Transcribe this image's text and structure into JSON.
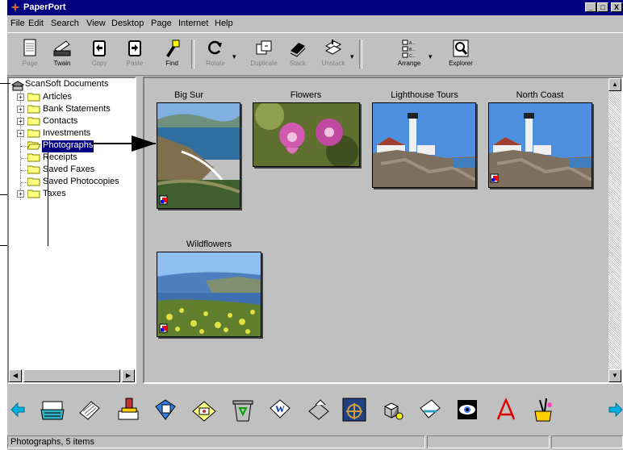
{
  "window": {
    "title": "PaperPort",
    "controls": {
      "minimize": "_",
      "maximize": "□",
      "close": "X"
    }
  },
  "menu": [
    "File",
    "Edit",
    "Search",
    "View",
    "Desktop",
    "Page",
    "Internet",
    "Help"
  ],
  "toolbar": [
    {
      "label": "Page",
      "icon": "page-icon",
      "enabled": false
    },
    {
      "label": "Twain",
      "icon": "scanner-icon",
      "enabled": true
    },
    {
      "label": "Copy",
      "icon": "copy-icon",
      "enabled": false
    },
    {
      "label": "Paste",
      "icon": "paste-icon",
      "enabled": false
    },
    {
      "label": "Find",
      "icon": "find-icon",
      "enabled": true
    },
    {
      "label": "Rotate",
      "icon": "rotate-icon",
      "enabled": false
    },
    {
      "label": "Duplicate",
      "icon": "duplicate-icon",
      "enabled": false
    },
    {
      "label": "Stack",
      "icon": "stack-icon",
      "enabled": false
    },
    {
      "label": "Unstack",
      "icon": "unstack-icon",
      "enabled": false
    },
    {
      "label": "Arrange",
      "icon": "arrange-icon",
      "enabled": true
    },
    {
      "label": "Explorer",
      "icon": "explorer-icon",
      "enabled": true
    }
  ],
  "tree": {
    "root": "ScanSoft Documents",
    "items": [
      {
        "label": "Articles",
        "expandable": true
      },
      {
        "label": "Bank Statements",
        "expandable": true
      },
      {
        "label": "Contacts",
        "expandable": true
      },
      {
        "label": "Investments",
        "expandable": true
      },
      {
        "label": "Photographs",
        "expandable": false,
        "selected": true
      },
      {
        "label": "Receipts",
        "expandable": false
      },
      {
        "label": "Saved Faxes",
        "expandable": false
      },
      {
        "label": "Saved Photocopies",
        "expandable": false
      },
      {
        "label": "Taxes",
        "expandable": true
      }
    ]
  },
  "thumbnails": [
    {
      "caption": "Big Sur",
      "kind": "coast-portrait"
    },
    {
      "caption": "Flowers",
      "kind": "flowers"
    },
    {
      "caption": "Lighthouse Tours",
      "kind": "lighthouse"
    },
    {
      "caption": "North Coast",
      "kind": "lighthouse"
    },
    {
      "caption": "Wildflowers",
      "kind": "wildflowers"
    }
  ],
  "sendto_bar": {
    "icons": [
      "left-arrow-icon",
      "typewriter-icon",
      "documents-icon",
      "stamp-icon",
      "fax-icon",
      "mail-icon",
      "recycle-icon",
      "word-icon",
      "printer-icon",
      "ship-icon",
      "cubes-icon",
      "envelope-icon",
      "eye-icon",
      "acrobat-icon",
      "paintbrush-icon",
      "right-arrow-icon"
    ]
  },
  "status": {
    "text": "Photographs, 5 items"
  },
  "colors": {
    "titlebar": "#000080",
    "face": "#c0c0c0",
    "selection": "#000080"
  }
}
